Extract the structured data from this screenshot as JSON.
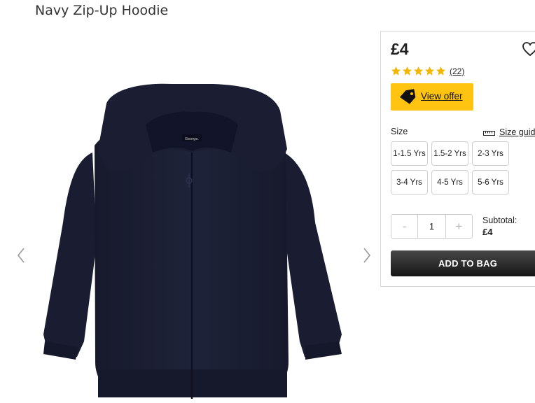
{
  "product": {
    "title": "Navy Zip-Up Hoodie",
    "brand_label": "George."
  },
  "gallery": {
    "prev_icon": "chevron-left-icon",
    "next_icon": "chevron-right-icon"
  },
  "purchase": {
    "price": "£4",
    "rating_stars": 5,
    "review_count": "(22)",
    "offer_label": "View offer",
    "size_label": "Size",
    "size_guide_label": "Size guid",
    "sizes": [
      "1-1.5 Yrs",
      "1.5-2 Yrs",
      "2-3 Yrs",
      "3-4 Yrs",
      "4-5 Yrs",
      "5-6 Yrs"
    ],
    "quantity": "1",
    "minus": "-",
    "plus": "+",
    "subtotal_label": "Subtotal:",
    "subtotal_value": "£4",
    "add_to_bag_label": "ADD TO BAG"
  },
  "colors": {
    "offer_yellow": "#ffc312",
    "star_gold": "#f2b600",
    "hoodie_navy": "#1c2036",
    "button_dark": "#222222"
  }
}
